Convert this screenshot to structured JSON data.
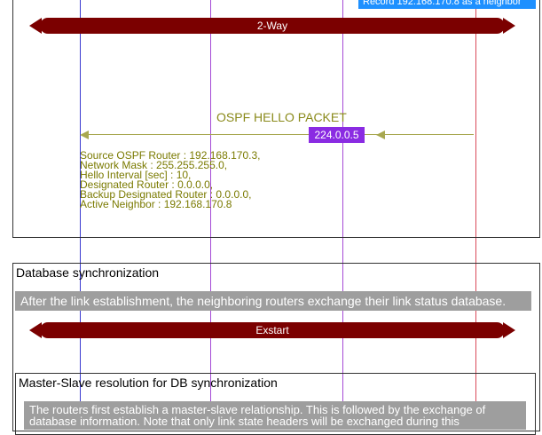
{
  "top_section": {
    "record_note": "Record 192.168.170.8 as a neighbor",
    "state_banner": "2-Way",
    "packet_title": "OSPF HELLO PACKET",
    "packet_destination": "224.0.0.5",
    "packet_fields": [
      "Source OSPF Router : 192.168.170.3,",
      "Network Mask : 255.255.255.0,",
      "Hello Interval [sec] : 10,",
      "Designated Router : 0.0.0.0,",
      "Backup Designated Router : 0.0.0.0,",
      "Active Neighbor : 192.168.170.8"
    ]
  },
  "db_sync": {
    "title": "Database synchronization",
    "description": "After the link establishment, the neighboring routers exchange their link status database.",
    "state_banner": "Exstart"
  },
  "master_slave": {
    "title": "Master-Slave resolution for DB synchronization",
    "description_line1": "The routers first establish a master-slave relationship. This is followed by the exchange of",
    "description_line2": "database information. Note that only link state headers will be exchanged during this"
  },
  "colors": {
    "lifeline_blue": "#3a3ad0",
    "lifeline_purple": "#a54ad6",
    "lifeline_red": "#d94a5a",
    "banner": "#7b0000",
    "arrow": "#a8a850"
  }
}
